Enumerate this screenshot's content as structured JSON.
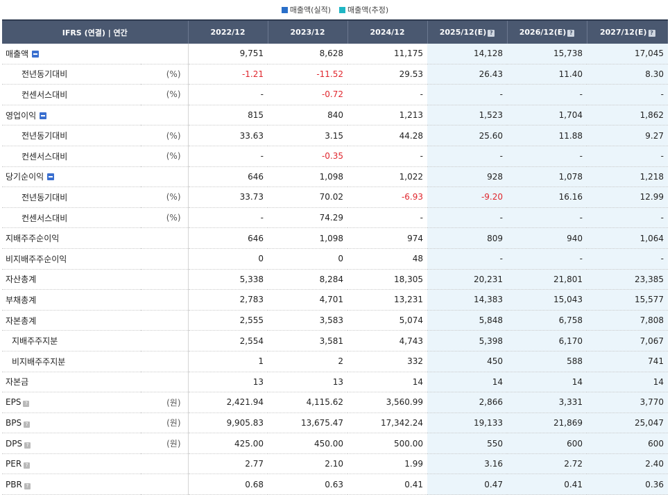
{
  "legend": [
    {
      "label": "매출액(실적)",
      "color": "#2a6fc9"
    },
    {
      "label": "매출액(추정)",
      "color": "#1fb6c4"
    }
  ],
  "header": {
    "label": "IFRS (연결) | 연간",
    "columns": [
      "2022/12",
      "2023/12",
      "2024/12",
      "2025/12(E)",
      "2026/12(E)",
      "2027/12(E)"
    ],
    "help_flags": [
      false,
      false,
      false,
      true,
      true,
      true
    ]
  },
  "rows": [
    {
      "label": "매출액",
      "indent": "none",
      "unit": "",
      "toggle": true,
      "help": false,
      "values": [
        "9,751",
        "8,628",
        "11,175",
        "14,128",
        "15,738",
        "17,045"
      ]
    },
    {
      "label": "전년동기대비",
      "indent": "sub",
      "unit": "(%)",
      "toggle": false,
      "help": false,
      "values": [
        "-1.21",
        "-11.52",
        "29.53",
        "26.43",
        "11.40",
        "8.30"
      ]
    },
    {
      "label": "컨센서스대비",
      "indent": "sub",
      "unit": "(%)",
      "toggle": false,
      "help": false,
      "values": [
        "-",
        "-0.72",
        "-",
        "-",
        "-",
        "-"
      ]
    },
    {
      "label": "영업이익",
      "indent": "none",
      "unit": "",
      "toggle": true,
      "help": false,
      "values": [
        "815",
        "840",
        "1,213",
        "1,523",
        "1,704",
        "1,862"
      ]
    },
    {
      "label": "전년동기대비",
      "indent": "sub",
      "unit": "(%)",
      "toggle": false,
      "help": false,
      "values": [
        "33.63",
        "3.15",
        "44.28",
        "25.60",
        "11.88",
        "9.27"
      ]
    },
    {
      "label": "컨센서스대비",
      "indent": "sub",
      "unit": "(%)",
      "toggle": false,
      "help": false,
      "values": [
        "-",
        "-0.35",
        "-",
        "-",
        "-",
        "-"
      ]
    },
    {
      "label": "당기순이익",
      "indent": "none",
      "unit": "",
      "toggle": true,
      "help": false,
      "values": [
        "646",
        "1,098",
        "1,022",
        "928",
        "1,078",
        "1,218"
      ]
    },
    {
      "label": "전년동기대비",
      "indent": "sub",
      "unit": "(%)",
      "toggle": false,
      "help": false,
      "values": [
        "33.73",
        "70.02",
        "-6.93",
        "-9.20",
        "16.16",
        "12.99"
      ]
    },
    {
      "label": "컨센서스대비",
      "indent": "sub",
      "unit": "(%)",
      "toggle": false,
      "help": false,
      "values": [
        "-",
        "74.29",
        "-",
        "-",
        "-",
        "-"
      ]
    },
    {
      "label": "지배주주순이익",
      "indent": "none",
      "unit": "",
      "toggle": false,
      "help": false,
      "values": [
        "646",
        "1,098",
        "974",
        "809",
        "940",
        "1,064"
      ]
    },
    {
      "label": "비지배주주순이익",
      "indent": "none",
      "unit": "",
      "toggle": false,
      "help": false,
      "values": [
        "0",
        "0",
        "48",
        "-",
        "-",
        "-"
      ]
    },
    {
      "label": "자산총계",
      "indent": "none",
      "unit": "",
      "toggle": false,
      "help": false,
      "values": [
        "5,338",
        "8,284",
        "18,305",
        "20,231",
        "21,801",
        "23,385"
      ]
    },
    {
      "label": "부채총계",
      "indent": "none",
      "unit": "",
      "toggle": false,
      "help": false,
      "values": [
        "2,783",
        "4,701",
        "13,231",
        "14,383",
        "15,043",
        "15,577"
      ]
    },
    {
      "label": "자본총계",
      "indent": "none",
      "unit": "",
      "toggle": false,
      "help": false,
      "values": [
        "2,555",
        "3,583",
        "5,074",
        "5,848",
        "6,758",
        "7,808"
      ]
    },
    {
      "label": "지배주주지분",
      "indent": "sub2",
      "unit": "",
      "toggle": false,
      "help": false,
      "values": [
        "2,554",
        "3,581",
        "4,743",
        "5,398",
        "6,170",
        "7,067"
      ]
    },
    {
      "label": "비지배주주지분",
      "indent": "sub2",
      "unit": "",
      "toggle": false,
      "help": false,
      "values": [
        "1",
        "2",
        "332",
        "450",
        "588",
        "741"
      ]
    },
    {
      "label": "자본금",
      "indent": "none",
      "unit": "",
      "toggle": false,
      "help": false,
      "values": [
        "13",
        "13",
        "14",
        "14",
        "14",
        "14"
      ]
    },
    {
      "label": "EPS",
      "indent": "none",
      "unit": "(원)",
      "toggle": false,
      "help": true,
      "values": [
        "2,421.94",
        "4,115.62",
        "3,560.99",
        "2,866",
        "3,331",
        "3,770"
      ]
    },
    {
      "label": "BPS",
      "indent": "none",
      "unit": "(원)",
      "toggle": false,
      "help": true,
      "values": [
        "9,905.83",
        "13,675.47",
        "17,342.24",
        "19,133",
        "21,869",
        "25,047"
      ]
    },
    {
      "label": "DPS",
      "indent": "none",
      "unit": "(원)",
      "toggle": false,
      "help": true,
      "values": [
        "425.00",
        "450.00",
        "500.00",
        "550",
        "600",
        "600"
      ]
    },
    {
      "label": "PER",
      "indent": "none",
      "unit": "",
      "toggle": false,
      "help": true,
      "values": [
        "2.77",
        "2.10",
        "1.99",
        "3.16",
        "2.72",
        "2.40"
      ]
    },
    {
      "label": "PBR",
      "indent": "none",
      "unit": "",
      "toggle": false,
      "help": true,
      "values": [
        "0.68",
        "0.63",
        "0.41",
        "0.47",
        "0.41",
        "0.36"
      ]
    }
  ],
  "estimate_start_index": 3,
  "colors": {
    "negative": "#e0262d",
    "estimate_bg": "#ebf5fb",
    "header_bg": "#4a5870"
  }
}
